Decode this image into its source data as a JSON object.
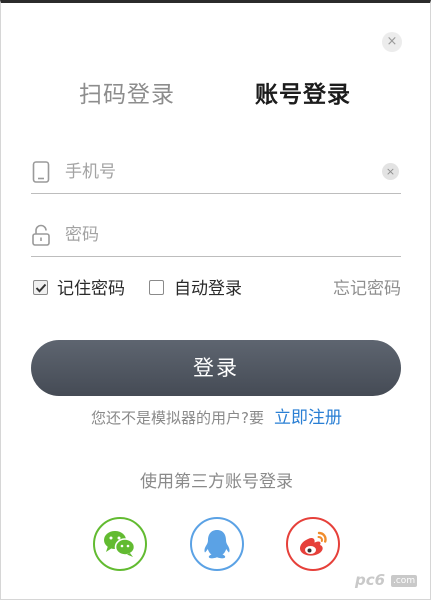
{
  "window": {
    "close_glyph": "×",
    "close_icon": "close-icon"
  },
  "tabs": {
    "qr_login": "扫码登录",
    "account_login": "账号登录"
  },
  "phone_field": {
    "icon": "phone-icon",
    "value": "",
    "placeholder": "手机号",
    "clear_glyph": "×"
  },
  "password_field": {
    "icon": "lock-icon",
    "value": "",
    "placeholder": "密码"
  },
  "options": {
    "remember_label": "记住密码",
    "remember_checked": true,
    "auto_login_label": "自动登录",
    "auto_login_checked": false,
    "forgot_label": "忘记密码"
  },
  "login_button": "登录",
  "register": {
    "prompt": "您还不是模拟器的用户?要",
    "link": "立即注册"
  },
  "third_party": {
    "title": "使用第三方账号登录",
    "providers": [
      {
        "name": "wechat",
        "icon": "wechat-icon",
        "color": "#62bb31"
      },
      {
        "name": "qq",
        "icon": "qq-icon",
        "color": "#5ba2e5"
      },
      {
        "name": "weibo",
        "icon": "weibo-icon",
        "color": "#e6403a"
      }
    ]
  },
  "watermark": {
    "text": "pc6",
    "suffix": ".com"
  }
}
